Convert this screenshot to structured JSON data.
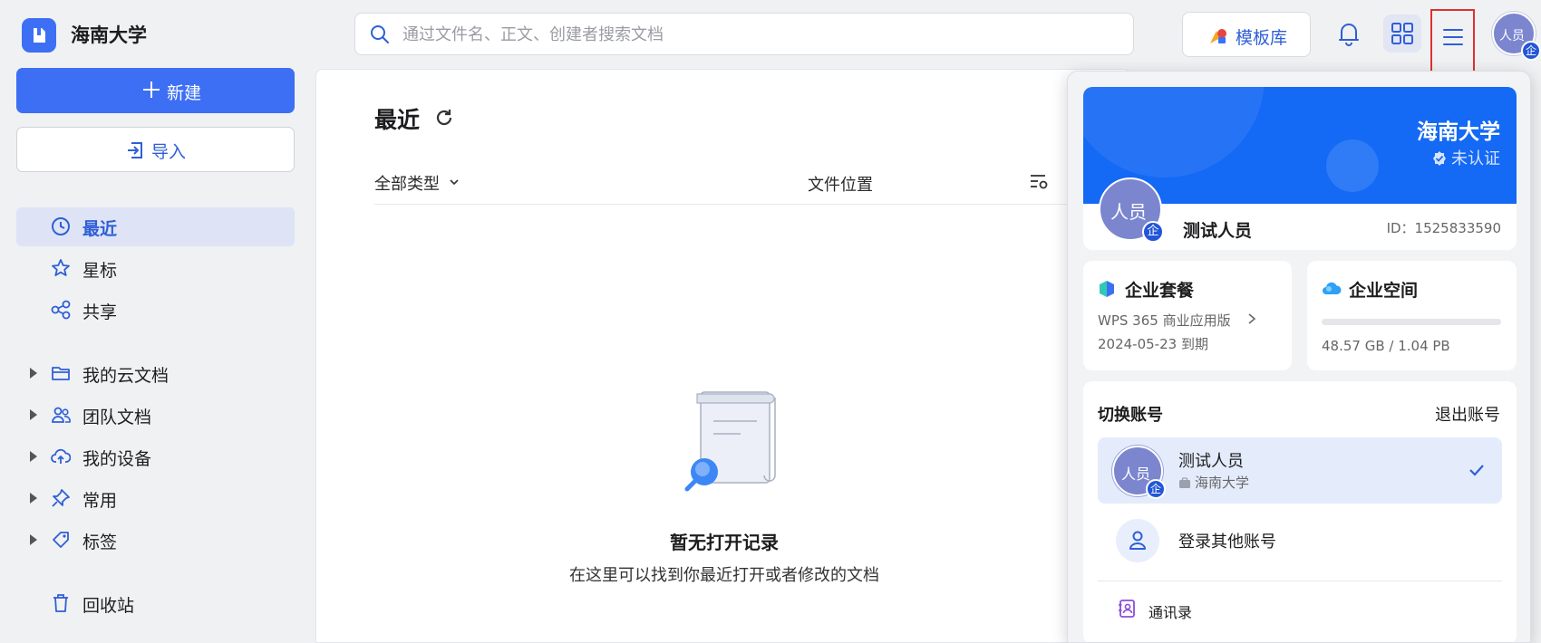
{
  "app": {
    "org_name": "海南大学"
  },
  "search": {
    "placeholder": "通过文件名、正文、创建者搜索文档"
  },
  "toolbar": {
    "template_label": "模板库",
    "avatar_text": "人员",
    "badge": "企"
  },
  "sidebar": {
    "new_label": "新建",
    "import_label": "导入",
    "items": [
      {
        "label": "最近",
        "icon": "clock-icon",
        "active": true
      },
      {
        "label": "星标",
        "icon": "star-icon"
      },
      {
        "label": "共享",
        "icon": "share-icon"
      },
      {
        "label": "我的云文档",
        "icon": "folder-icon",
        "expandable": true
      },
      {
        "label": "团队文档",
        "icon": "team-icon",
        "expandable": true
      },
      {
        "label": "我的设备",
        "icon": "cloud-upload-icon",
        "expandable": true
      },
      {
        "label": "常用",
        "icon": "pin-icon",
        "expandable": true
      },
      {
        "label": "标签",
        "icon": "tag-icon",
        "expandable": true
      },
      {
        "label": "回收站",
        "icon": "trash-icon"
      }
    ]
  },
  "main": {
    "title": "最近",
    "filter_type": "全部类型",
    "col_location": "文件位置",
    "empty_title": "暂无打开记录",
    "empty_subtitle": "在这里可以找到你最近打开或者修改的文档"
  },
  "popover": {
    "org_name": "海南大学",
    "verify_status": "未认证",
    "avatar_text": "人员",
    "badge": "企",
    "user_name": "测试人员",
    "user_id": "ID：1525833590",
    "package": {
      "title": "企业套餐",
      "plan": "WPS 365 商业应用版",
      "expiry": "2024-05-23 到期"
    },
    "space": {
      "title": "企业空间",
      "usage_text": "48.57 GB / 1.04 PB",
      "usage_fraction": 4.56e-05
    },
    "accounts": {
      "title": "切换账号",
      "logout_label": "退出账号",
      "current": {
        "name": "测试人员",
        "org": "海南大学",
        "avatar_text": "人员",
        "badge": "企"
      },
      "login_other_label": "登录其他账号",
      "contacts_label": "通讯录"
    }
  },
  "colors": {
    "accent": "#3d6ff5",
    "banner": "#1469f5",
    "highlight_box": "#e03030"
  }
}
